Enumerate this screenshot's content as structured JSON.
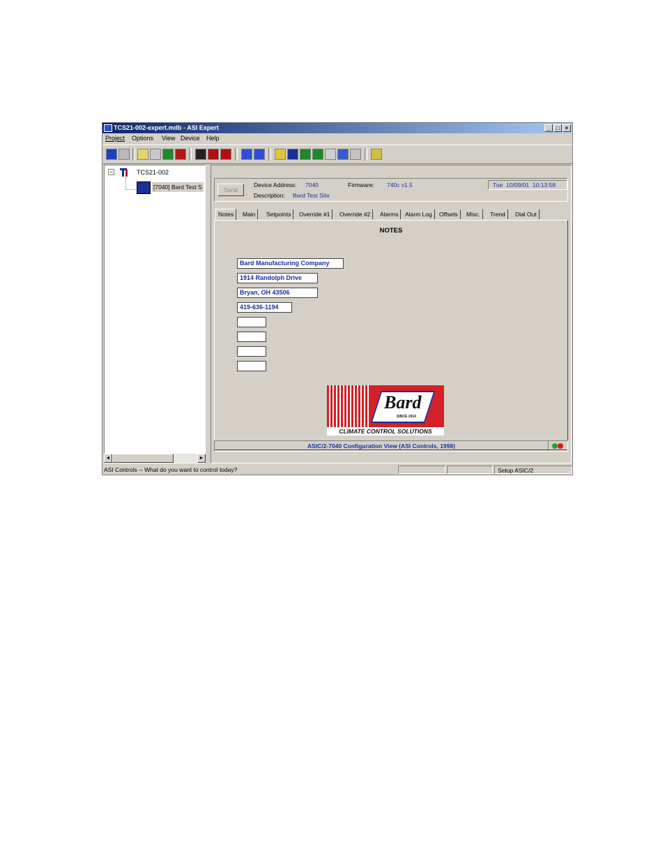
{
  "window": {
    "title": "TCS21-002-expert.mdb - ASI Expert",
    "controls": [
      "_",
      "□",
      "×"
    ]
  },
  "menu": [
    "Project",
    "Options",
    "View",
    "Device",
    "Help"
  ],
  "toolbar_icons": [
    "connect-icon",
    "wrench-icon",
    "open-icon",
    "list-icon",
    "binoculars-icon",
    "sync-icon",
    "save-icon",
    "save-red-icon",
    "save-all-icon",
    "dos-icon",
    "dos2-icon",
    "home-icon",
    "ti-icon",
    "green-screen-icon",
    "green-screen2-icon",
    "grid-icon",
    "clock-icon",
    "table-icon",
    "report-icon"
  ],
  "tree": {
    "root": "TCS21-002",
    "child": "[7040] Bard Test S"
  },
  "device": {
    "send_label": "Send",
    "address_label": "Device Address:",
    "address_value": "7040",
    "firmware_label": "Firmware:",
    "firmware_value": "740c v1.5",
    "description_label": "Description:",
    "description_value": "Bard Test Site",
    "datetime": "Tue  10/09/01  10:13:58"
  },
  "tabs": [
    "Notes",
    "Main",
    "Setpoints",
    "Override #1",
    "Override #2",
    "Alarms",
    "Alarm Log",
    "Offsets",
    "Misc.",
    "Trend",
    "Dial Out"
  ],
  "notes": {
    "heading": "NOTES",
    "lines": [
      "Bard Manufacturing Company",
      "1914 Randolph Drive",
      "Bryan, OH 43506",
      "419-636-1194",
      "",
      "",
      "",
      ""
    ]
  },
  "logo": {
    "name": "Bard",
    "since": "SINCE 1914",
    "tagline": "CLIMATE CONTROL SOLUTIONS"
  },
  "footer_text": "ASIC/2-7040 Configuration View (ASI Controls, 1998)",
  "status": {
    "message": "ASI Controls -- What do you want to control today?",
    "right": "Setup ASIC/2"
  }
}
